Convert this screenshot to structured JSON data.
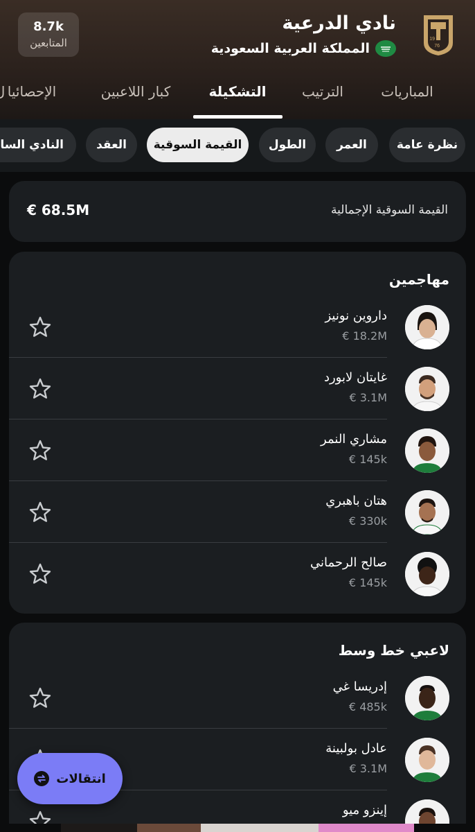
{
  "header": {
    "club_name": "نادي الدرعية",
    "country": "المملكة العربية السعودية",
    "followers_count": "8.7k",
    "followers_label": "المتابعين",
    "logo_year_top": "19",
    "logo_year_bottom": "76"
  },
  "tabs": [
    {
      "label": "ل"
    },
    {
      "label": "المباريات"
    },
    {
      "label": "الترتيب"
    },
    {
      "label": "التشكيلة",
      "active": true
    },
    {
      "label": "كبار اللاعبين"
    },
    {
      "label": "الإحصائيا"
    }
  ],
  "chips": [
    {
      "label": "نظرة عامة"
    },
    {
      "label": "العمر"
    },
    {
      "label": "الطول"
    },
    {
      "label": "القيمة السوقية",
      "active": true
    },
    {
      "label": "العقد"
    },
    {
      "label": "النادي السابق"
    }
  ],
  "total": {
    "label": "القيمة السوقية الإجمالية",
    "value": "€ 68.5M"
  },
  "sections": [
    {
      "title": "مهاجمين",
      "players": [
        {
          "name": "داروين نونيز",
          "value": "€ 18.2M"
        },
        {
          "name": "غايتان لابورد",
          "value": "€ 3.1M"
        },
        {
          "name": "مشاري النمر",
          "value": "€ 145k"
        },
        {
          "name": "هتان باهبري",
          "value": "€ 330k"
        },
        {
          "name": "صالح الرحماني",
          "value": "€ 145k"
        }
      ]
    },
    {
      "title": "لاعبي خط وسط",
      "players": [
        {
          "name": "إدريسا غي",
          "value": "€ 485k"
        },
        {
          "name": "عادل بولبينة",
          "value": "€ 3.1M"
        },
        {
          "name": "إينزو ميو",
          "value": ""
        }
      ]
    }
  ],
  "fab": {
    "label": "انتقالات",
    "icon": "transfer-arrows-icon"
  },
  "colors": {
    "accent_fab": "#7b7cf6",
    "card_bg": "#1b1e21",
    "chip_bg": "#2a2d30",
    "chip_active_bg": "#ececec",
    "header_bg": "#2c221d",
    "logo_gold": "#c9a56a",
    "flag_green": "#1f8a43"
  }
}
